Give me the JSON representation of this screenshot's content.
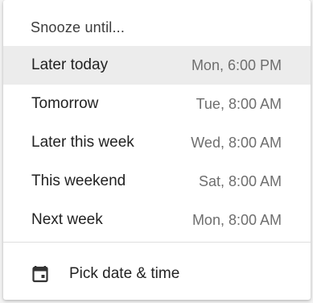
{
  "menu": {
    "header": "Snooze until...",
    "options": [
      {
        "label": "Later today",
        "time": "Mon, 6:00 PM",
        "highlighted": true
      },
      {
        "label": "Tomorrow",
        "time": "Tue, 8:00 AM",
        "highlighted": false
      },
      {
        "label": "Later this week",
        "time": "Wed, 8:00 AM",
        "highlighted": false
      },
      {
        "label": "This weekend",
        "time": "Sat, 8:00 AM",
        "highlighted": false
      },
      {
        "label": "Next week",
        "time": "Mon, 8:00 AM",
        "highlighted": false
      }
    ],
    "pick": {
      "label": "Pick date & time",
      "icon": "calendar-icon"
    }
  },
  "colors": {
    "highlight": "#ececec",
    "text": "#222222",
    "secondary_text": "#6e6e6e",
    "icon": "#333333"
  }
}
